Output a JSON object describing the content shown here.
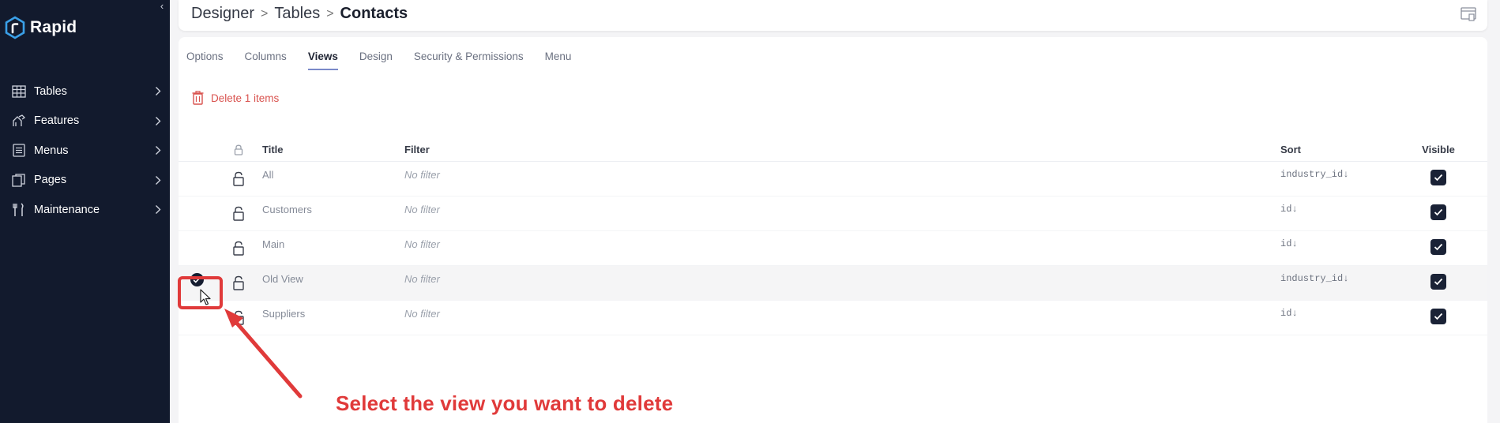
{
  "app": {
    "name": "Rapid"
  },
  "sidebar": {
    "items": [
      {
        "label": "Tables",
        "icon": "table-icon"
      },
      {
        "label": "Features",
        "icon": "features-icon"
      },
      {
        "label": "Menus",
        "icon": "menu-list-icon"
      },
      {
        "label": "Pages",
        "icon": "pages-icon"
      },
      {
        "label": "Maintenance",
        "icon": "wrench-icon"
      }
    ]
  },
  "breadcrumb": {
    "part1": "Designer",
    "part2": "Tables",
    "current": "Contacts"
  },
  "tabs": [
    {
      "label": "Options"
    },
    {
      "label": "Columns"
    },
    {
      "label": "Views",
      "active": true
    },
    {
      "label": "Design"
    },
    {
      "label": "Security & Permissions"
    },
    {
      "label": "Menu"
    }
  ],
  "toolbar": {
    "delete_label": "Delete 1 items"
  },
  "table": {
    "headers": {
      "title": "Title",
      "filter": "Filter",
      "sort": "Sort",
      "visible": "Visible"
    },
    "rows": [
      {
        "title": "All",
        "filter": "No filter",
        "sort": "industry_id↓",
        "visible": true,
        "selected": false
      },
      {
        "title": "Customers",
        "filter": "No filter",
        "sort": "id↓",
        "visible": true,
        "selected": false
      },
      {
        "title": "Main",
        "filter": "No filter",
        "sort": "id↓",
        "visible": true,
        "selected": false
      },
      {
        "title": "Old View",
        "filter": "No filter",
        "sort": "industry_id↓",
        "visible": true,
        "selected": true
      },
      {
        "title": "Suppliers",
        "filter": "No filter",
        "sort": "id↓",
        "visible": true,
        "selected": false
      }
    ]
  },
  "annotation": {
    "text": "Select the view you want to delete"
  },
  "colors": {
    "sidebar_bg": "#121a2d",
    "accent": "#7a89c9",
    "danger": "#d9534f",
    "annotation": "#e03a3a"
  }
}
